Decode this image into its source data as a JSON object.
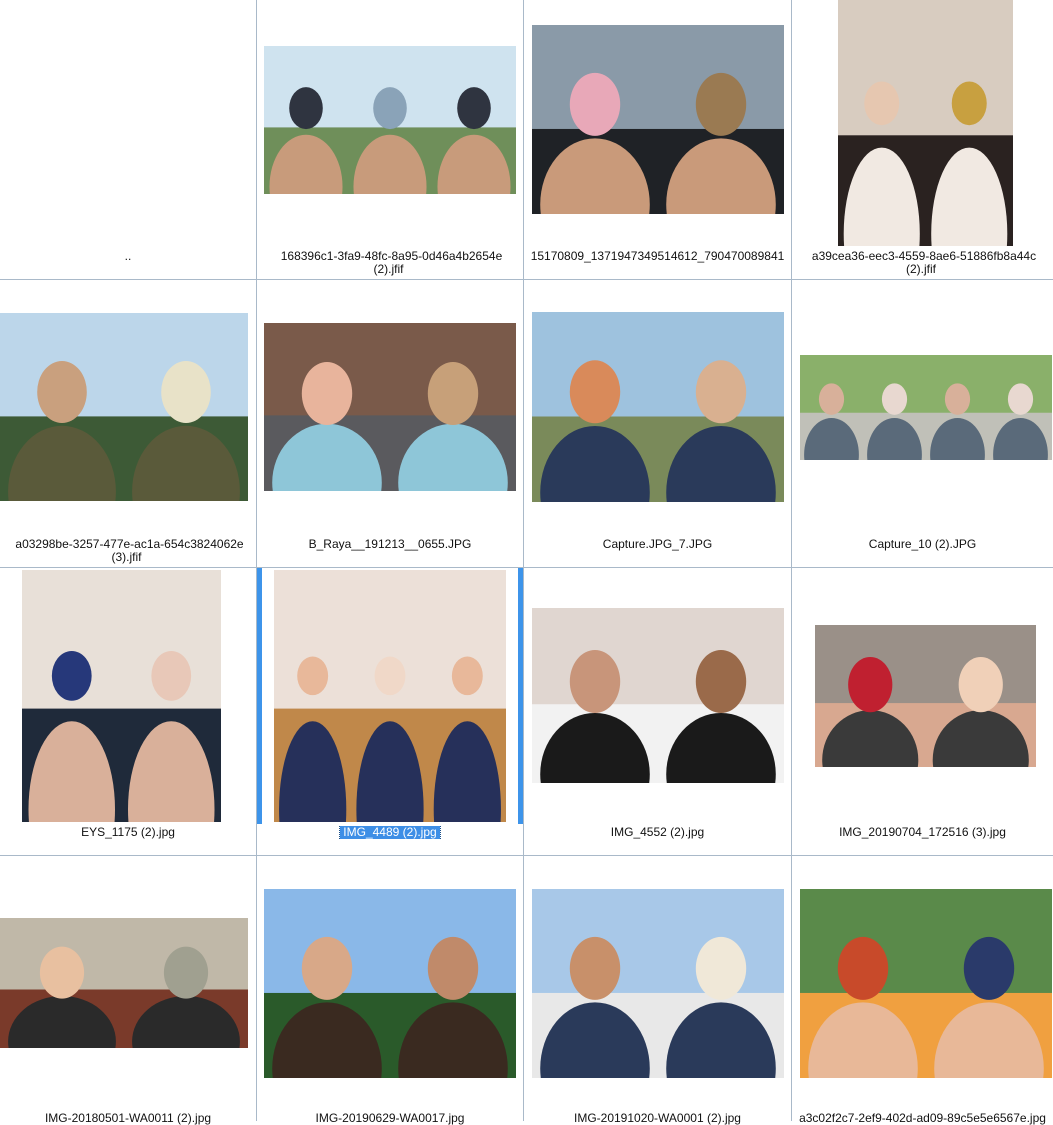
{
  "window": {
    "items": [
      {
        "name": "..",
        "kind": "parent-folder",
        "photo": null
      },
      {
        "name": "168396c1-3fa9-48fc-8a95-0d46a4b2654e\n(2).jfif",
        "kind": "image",
        "photo": "three-men-selfie"
      },
      {
        "name": "15170809_1371947349514612_790470089841",
        "kind": "image",
        "photo": "couple-winter-selfie"
      },
      {
        "name": "a39cea36-eec3-4559-8ae6-51886fb8a44c\n(2).jfif",
        "kind": "image",
        "photo": "woman-with-glass"
      },
      {
        "name": "a03298be-3257-477e-ac1a-654c3824062e\n(3).jfif",
        "kind": "image",
        "photo": "man-with-camera-palms"
      },
      {
        "name": "B_Raya__191213__0655.JPG",
        "kind": "image",
        "photo": "smiling-woman-cafe"
      },
      {
        "name": "Capture.JPG_7.JPG",
        "kind": "image",
        "photo": "couple-valley-selfie"
      },
      {
        "name": "Capture_10 (2).JPG",
        "kind": "image",
        "photo": "four-children-outdoors"
      },
      {
        "name": "EYS_1175 (2).jpg",
        "kind": "image",
        "photo": "family-portrait"
      },
      {
        "name": "IMG_4489 (2).jpg",
        "kind": "image",
        "photo": "three-women-portrait",
        "selected": true
      },
      {
        "name": "IMG_4552 (2).jpg",
        "kind": "image",
        "photo": "older-couple"
      },
      {
        "name": "IMG_20190704_172516 (3).jpg",
        "kind": "image",
        "photo": "man-sunglasses-selfie"
      },
      {
        "name": "IMG-20180501-WA0011 (2).jpg",
        "kind": "image",
        "photo": "two-women-street"
      },
      {
        "name": "IMG-20190629-WA0017.jpg",
        "kind": "image",
        "photo": "teens-by-lake"
      },
      {
        "name": "IMG-20191020-WA0001 (2).jpg",
        "kind": "image",
        "photo": "man-and-boys"
      },
      {
        "name": "a3c02f2c7-2ef9-402d-ad09-89c5e5e6567e.jpg",
        "kind": "image",
        "photo": "woman-children-campfire"
      }
    ]
  },
  "colors": {
    "grid_line": "#a9b9c9",
    "selection": "#3d8ee6",
    "selection_bar": "#3d94ea"
  }
}
